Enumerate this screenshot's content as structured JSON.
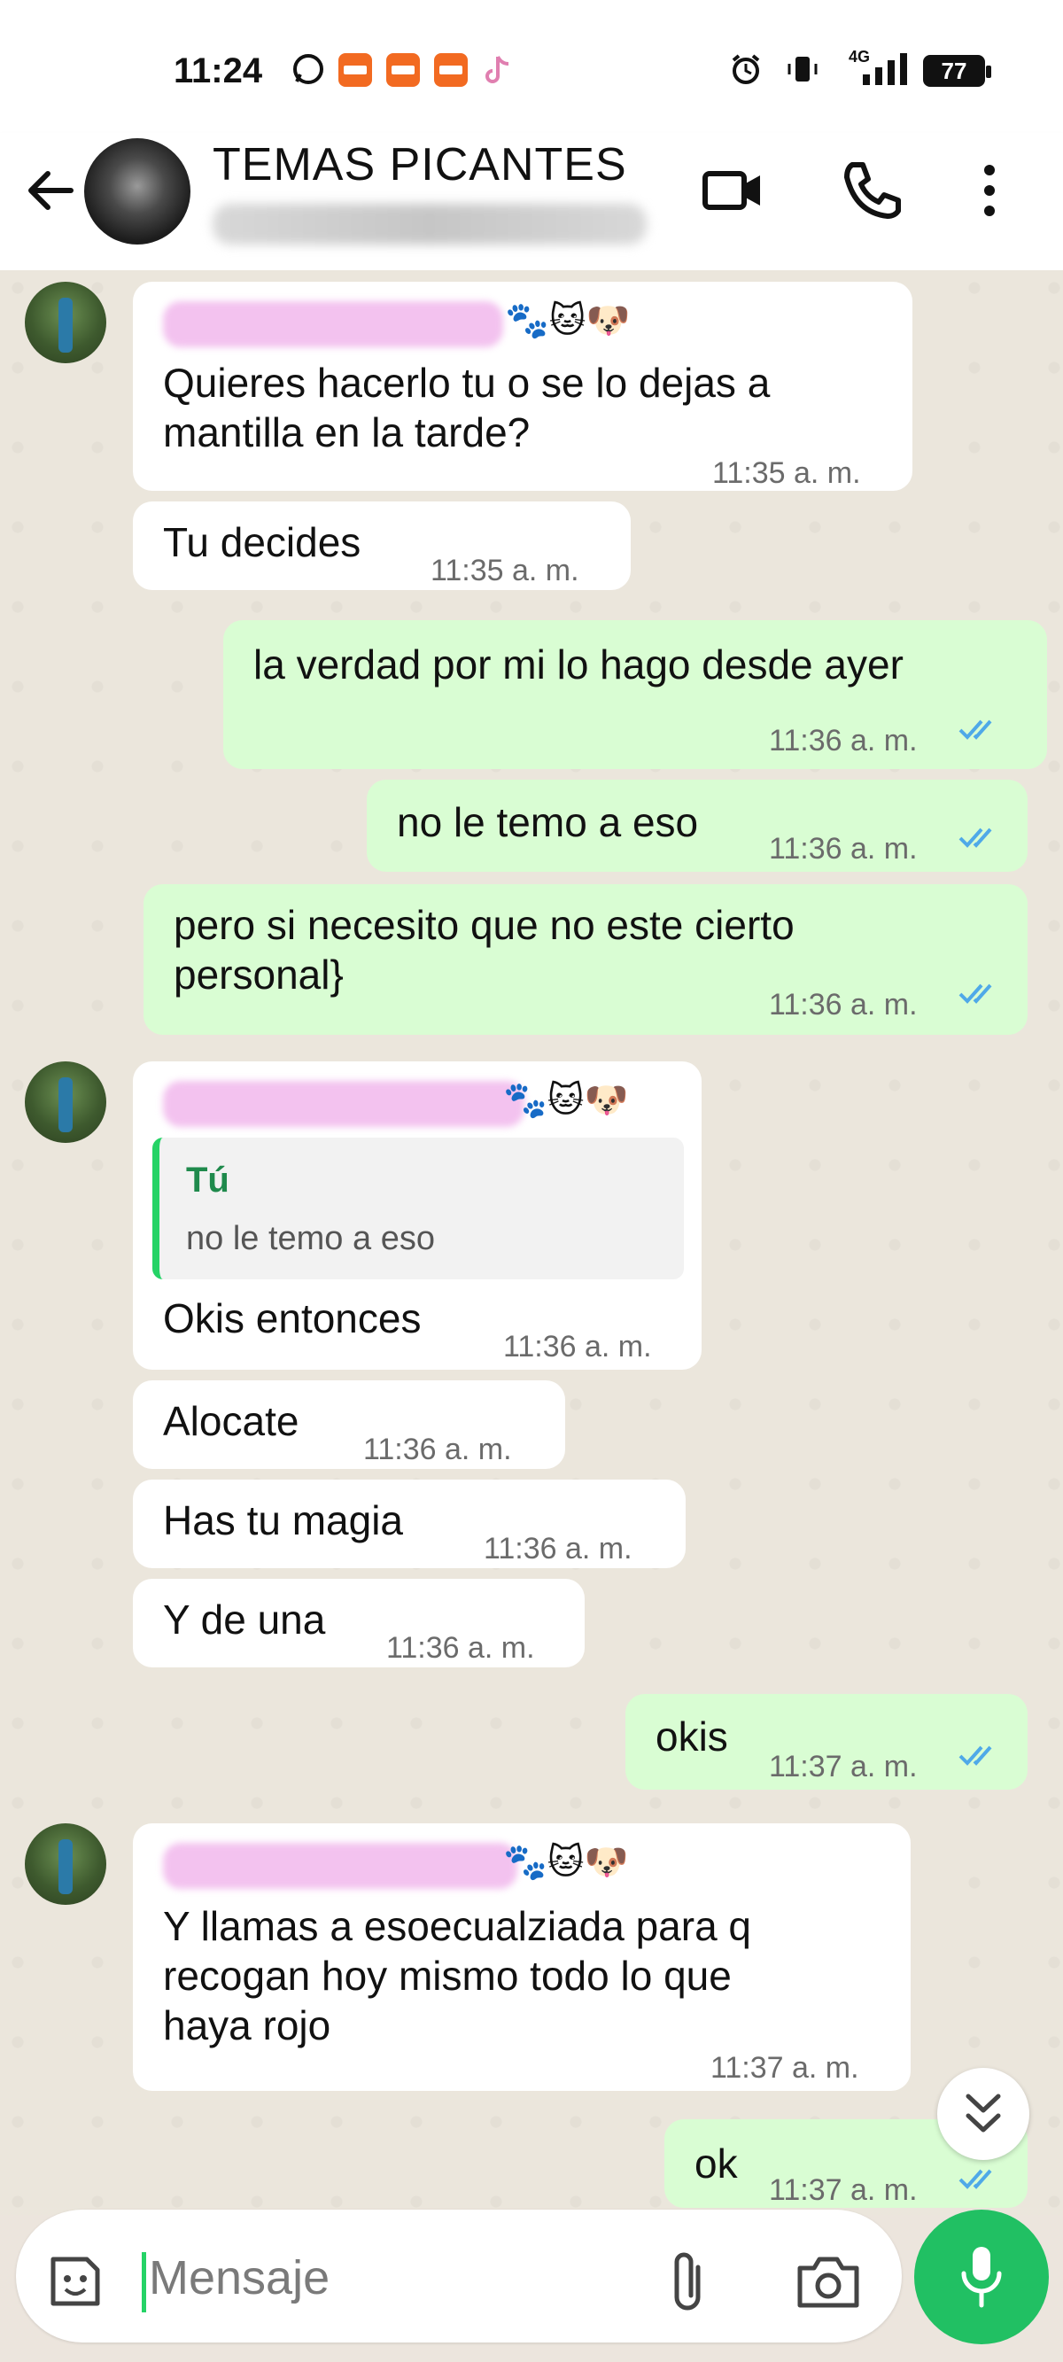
{
  "status_bar": {
    "time": "11:24",
    "network": "4G",
    "battery": "77"
  },
  "header": {
    "title": "TEMAS PICANTES"
  },
  "messages": [
    {
      "direction": "in",
      "text": "Quieres hacerlo tu o se lo dejas a\nmantilla en la tarde?",
      "time": "11:35 a. m.",
      "emojis": "🐾🐱🐶"
    },
    {
      "direction": "in",
      "text": "Tu decides",
      "time": "11:35 a. m."
    },
    {
      "direction": "out",
      "text": "la verdad por mi lo hago desde ayer",
      "time": "11:36 a. m.",
      "status": "read"
    },
    {
      "direction": "out",
      "text": "no le temo a eso",
      "time": "11:36 a. m.",
      "status": "read"
    },
    {
      "direction": "out",
      "text": "pero si necesito que no este cierto\npersonal}",
      "time": "11:36 a. m.",
      "status": "read"
    },
    {
      "direction": "in",
      "text": "Okis entonces",
      "time": "11:36 a. m.",
      "emojis": "🐾🐱🐶",
      "quote": {
        "author": "Tú",
        "text": "no le temo a eso"
      }
    },
    {
      "direction": "in",
      "text": "Alocate",
      "time": "11:36 a. m."
    },
    {
      "direction": "in",
      "text": "Has tu magia",
      "time": "11:36 a. m."
    },
    {
      "direction": "in",
      "text": "Y de una",
      "time": "11:36 a. m."
    },
    {
      "direction": "out",
      "text": "okis",
      "time": "11:37 a. m.",
      "status": "read"
    },
    {
      "direction": "in",
      "text": "Y llamas a esoecualziada para q\nrecogan hoy mismo todo lo que\nhaya rojo",
      "time": "11:37 a. m.",
      "emojis": "🐾🐱🐶"
    },
    {
      "direction": "out",
      "text": "ok",
      "time": "11:37 a. m.",
      "status": "read"
    }
  ],
  "composer": {
    "placeholder": "Mensaje"
  },
  "colors": {
    "outgoing_bubble": "#d9fdd3",
    "incoming_bubble": "#ffffff",
    "accent_green": "#21c063",
    "read_ticks": "#4fa9e8"
  },
  "icons": [
    "back-arrow-icon",
    "video-call-icon",
    "phone-icon",
    "more-options-icon",
    "sticker-icon",
    "attach-icon",
    "camera-icon",
    "mic-icon",
    "scroll-down-icon"
  ]
}
